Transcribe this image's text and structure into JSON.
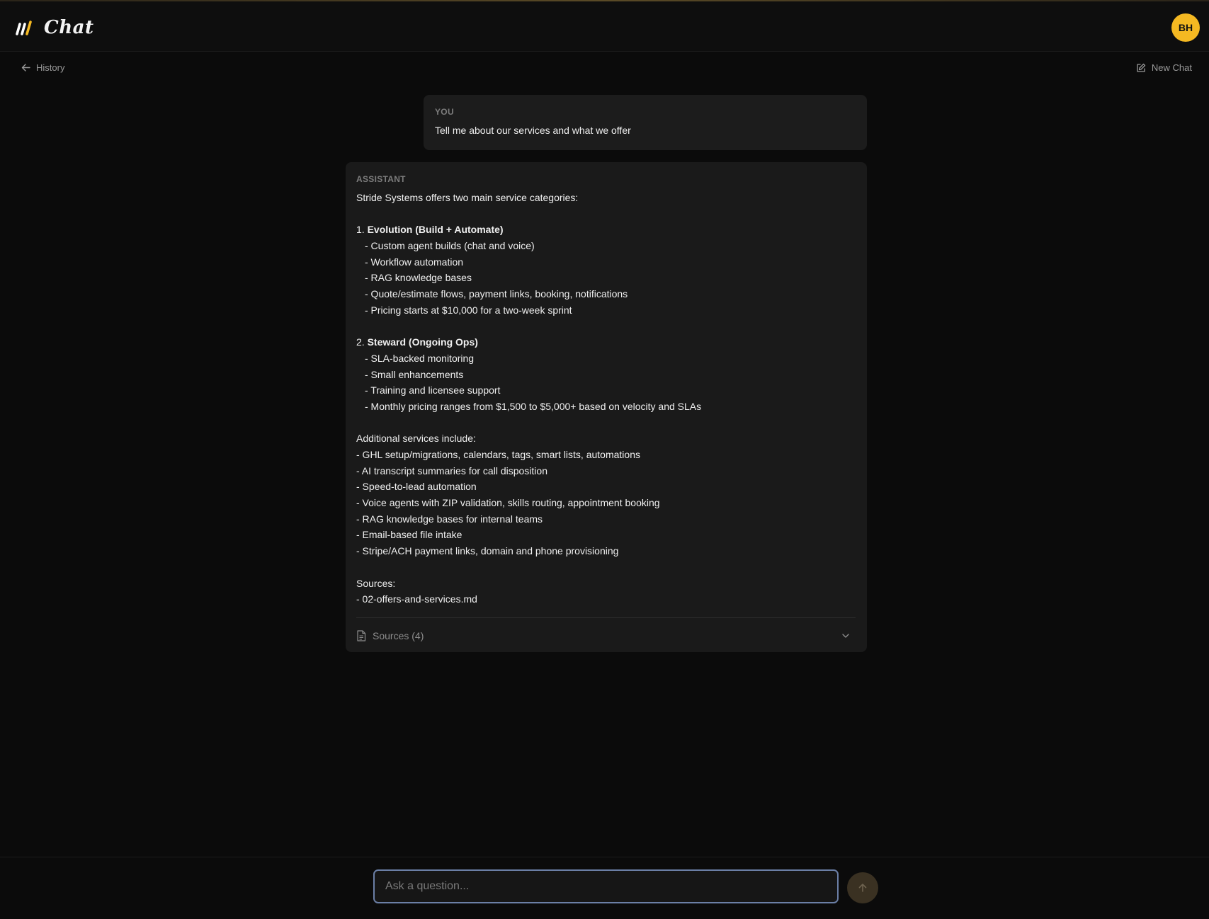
{
  "app": {
    "title": "Chat",
    "logo_icon": "brand-slashes-icon",
    "accent_color": "#f5b922"
  },
  "header": {
    "avatar_initials": "BH"
  },
  "nav": {
    "history_label": "History",
    "new_chat_label": "New Chat"
  },
  "conversation": {
    "user_message": {
      "role": "YOU",
      "text": "Tell me about our services and what we offer"
    },
    "assistant_message": {
      "role": "ASSISTANT",
      "intro": "Stride Systems offers two main service categories:",
      "section1": {
        "number": "1. ",
        "title": "Evolution (Build + Automate)",
        "items": [
          "- Custom agent builds (chat and voice)",
          "- Workflow automation",
          "- RAG knowledge bases",
          "- Quote/estimate flows, payment links, booking, notifications",
          "- Pricing starts at $10,000 for a two-week sprint"
        ]
      },
      "section2": {
        "number": "2. ",
        "title": "Steward (Ongoing Ops)",
        "items": [
          "- SLA-backed monitoring",
          "- Small enhancements",
          "- Training and licensee support",
          "- Monthly pricing ranges from $1,500 to $5,000+ based on velocity and SLAs"
        ]
      },
      "additional_heading": "Additional services include:",
      "additional_items": [
        "- GHL setup/migrations, calendars, tags, smart lists, automations",
        "- AI transcript summaries for call disposition",
        "- Speed-to-lead automation",
        "- Voice agents with ZIP validation, skills routing, appointment booking",
        "- RAG knowledge bases for internal teams",
        "- Email-based file intake",
        "- Stripe/ACH payment links, domain and phone provisioning"
      ],
      "sources_heading": "Sources:",
      "sources_items": [
        "- 02-offers-and-services.md"
      ],
      "sources_toggle_label": "Sources (4)"
    }
  },
  "composer": {
    "placeholder": "Ask a question...",
    "value": ""
  }
}
